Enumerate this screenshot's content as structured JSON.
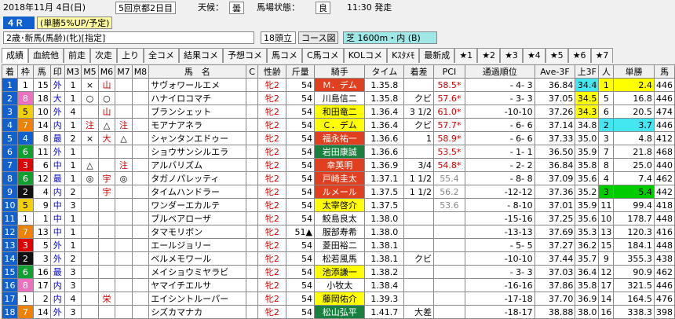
{
  "header": {
    "date": "2018年11月 4日(日)",
    "meeting": "5回京都2日目",
    "weather_label": "天候：",
    "weather": "曇",
    "track_label": "馬場状態：",
    "track": "良",
    "post_time": "11:30 発走"
  },
  "race": {
    "number": "４Ｒ",
    "odds_note": "(単勝5%UP/予定)",
    "conditions": "2歳･新馬(馬齢)(牝)[指定]",
    "head_count": "18頭立",
    "course_btn": "コース図",
    "course": "芝 1600m・内 (B)"
  },
  "tabs": [
    "成績",
    "血統他",
    "前走",
    "次走",
    "上り",
    "全コメ",
    "結果コメ",
    "予想コメ",
    "馬コメ",
    "C馬コメ",
    "KOLコメ",
    "Kｽﾀﾒﾓ",
    "最新成",
    "★1",
    "★2",
    "★3",
    "★4",
    "★5",
    "★6",
    "★7"
  ],
  "colors": {
    "waku": [
      "#ffffff",
      "#111111",
      "#e00000",
      "#1060d0",
      "#f0d000",
      "#10a030",
      "#f08000",
      "#f070c0"
    ],
    "waku_text": [
      "#000000",
      "#ffffff",
      "#ffffff",
      "#ffffff",
      "#000000",
      "#ffffff",
      "#ffffff",
      "#ffffff"
    ]
  },
  "columns": [
    "着",
    "枠",
    "馬",
    "印",
    "M3",
    "M5",
    "M6",
    "M7",
    "M8",
    "馬　名",
    "C",
    "性齢",
    "斤量",
    "騎手",
    "タイム",
    "着差",
    "PCI",
    "通過順位",
    "Ave-3F",
    "上3F",
    "人",
    "単勝",
    "馬"
  ],
  "rows": [
    {
      "rank": "1",
      "waku": "1",
      "num": "15",
      "mark": "外",
      "m3": "1",
      "m5": "×",
      "m6": "山",
      "m7": "",
      "m8": "",
      "name": "サヴォワールエメ",
      "c": "",
      "sex": "牝2",
      "wt": "54",
      "wt_mark": "",
      "jockey": "Ｍ．デム",
      "jbg": "#e04020",
      "jfg": "#ffffff",
      "time": "1.35.8",
      "margin": "",
      "pci": "58.5*",
      "pass": "- 4- 3",
      "ave": "36.84",
      "up3": "34.4",
      "up3bg": "cyn",
      "pop": "1",
      "popbg": "ylw",
      "odds": "2.4",
      "oddsbg": "ylw",
      "last": "446"
    },
    {
      "rank": "2",
      "waku": "8",
      "num": "18",
      "mark": "大",
      "m3": "1",
      "m5": "○",
      "m6": "○",
      "m7": "",
      "m8": "",
      "name": "ハナイロコマチ",
      "c": "",
      "sex": "牝2",
      "wt": "54",
      "wt_mark": "",
      "jockey": "川島信二",
      "jbg": "#ffffff",
      "jfg": "#000000",
      "time": "1.35.8",
      "margin": "クビ",
      "pci": "57.6*",
      "pass": "- 3- 3",
      "ave": "37.05",
      "up3": "34.5",
      "up3bg": "ylw",
      "pop": "5",
      "popbg": "",
      "odds": "16.8",
      "oddsbg": "",
      "last": "446"
    },
    {
      "rank": "3",
      "waku": "5",
      "num": "10",
      "mark": "外",
      "m3": "4",
      "m5": "",
      "m6": "山",
      "m7": "",
      "m8": "",
      "name": "ブランシェット",
      "c": "",
      "sex": "牝2",
      "wt": "54",
      "wt_mark": "",
      "jockey": "和田竜二",
      "jbg": "#ffff00",
      "jfg": "#000000",
      "time": "1.36.4",
      "margin": "3 1/2",
      "pci": "61.0*",
      "pass": "-10-10",
      "ave": "37.26",
      "up3": "34.3",
      "up3bg": "ylw",
      "pop": "6",
      "popbg": "",
      "odds": "20.5",
      "oddsbg": "",
      "last": "474"
    },
    {
      "rank": "4",
      "waku": "7",
      "num": "14",
      "mark": "内",
      "m3": "1",
      "m5": "注",
      "m6": "△",
      "m7": "注",
      "m8": "",
      "name": "モアナアネラ",
      "c": "",
      "sex": "牝2",
      "wt": "54",
      "wt_mark": "",
      "jockey": "Ｃ．デム",
      "jbg": "#ffff00",
      "jfg": "#000000",
      "time": "1.36.4",
      "margin": "クビ",
      "pci": "57.7*",
      "pass": "- 6- 6",
      "ave": "37.14",
      "up3": "34.8",
      "up3bg": "",
      "pop": "2",
      "popbg": "cyn",
      "odds": "3.7",
      "oddsbg": "cyn",
      "last": "446"
    },
    {
      "rank": "5",
      "waku": "4",
      "num": "8",
      "mark": "最",
      "m3": "2",
      "m5": "×",
      "m6": "大",
      "m7": "△",
      "m8": "",
      "name": "シャンタンエドゥー",
      "c": "",
      "sex": "牝2",
      "wt": "54",
      "wt_mark": "",
      "jockey": "福永祐一",
      "jbg": "#e04020",
      "jfg": "#ffffff",
      "time": "1.36.6",
      "margin": "1",
      "pci": "58.9*",
      "pass": "- 6- 6",
      "ave": "37.33",
      "up3": "35.0",
      "up3bg": "",
      "pop": "3",
      "popbg": "",
      "odds": "4.8",
      "oddsbg": "",
      "last": "412"
    },
    {
      "rank": "6",
      "waku": "6",
      "num": "11",
      "mark": "外",
      "m3": "1",
      "m5": "",
      "m6": "",
      "m7": "",
      "m8": "",
      "name": "ショウサンシルエラ",
      "c": "",
      "sex": "牝2",
      "wt": "54",
      "wt_mark": "",
      "jockey": "岩田康誠",
      "jbg": "#1a8040",
      "jfg": "#ffffff",
      "time": "1.36.6",
      "margin": "",
      "pci": "53.5*",
      "pass": "- 1- 1",
      "ave": "36.50",
      "up3": "35.9",
      "up3bg": "",
      "pop": "7",
      "popbg": "",
      "odds": "21.8",
      "oddsbg": "",
      "last": "468"
    },
    {
      "rank": "7",
      "waku": "3",
      "num": "6",
      "mark": "中",
      "m3": "1",
      "m5": "△",
      "m6": "",
      "m7": "注",
      "m8": "",
      "name": "アルバリズム",
      "c": "",
      "sex": "牝2",
      "wt": "54",
      "wt_mark": "",
      "jockey": "幸英明",
      "jbg": "#e04020",
      "jfg": "#ffffff",
      "time": "1.36.9",
      "margin": "3/4",
      "pci": "54.8*",
      "pass": "- 2- 2",
      "ave": "36.84",
      "up3": "35.8",
      "up3bg": "",
      "pop": "8",
      "popbg": "",
      "odds": "25.0",
      "oddsbg": "",
      "last": "440"
    },
    {
      "rank": "8",
      "waku": "6",
      "num": "12",
      "mark": "最",
      "m3": "1",
      "m5": "◎",
      "m6": "宇",
      "m7": "◎",
      "m8": "",
      "name": "タガノパレッティ",
      "c": "",
      "sex": "牝2",
      "wt": "54",
      "wt_mark": "",
      "jockey": "戸崎圭太",
      "jbg": "#e04020",
      "jfg": "#ffffff",
      "time": "1.37.1",
      "margin": "1 1/2",
      "pci": "55.4",
      "pass": "- 8- 8",
      "ave": "37.09",
      "up3": "35.6",
      "up3bg": "",
      "pop": "4",
      "popbg": "",
      "odds": "7.4",
      "oddsbg": "",
      "last": "462"
    },
    {
      "rank": "9",
      "waku": "2",
      "num": "4",
      "mark": "内",
      "m3": "2",
      "m5": "",
      "m6": "宇",
      "m7": "",
      "m8": "",
      "name": "タイムハンドラー",
      "c": "",
      "sex": "牝2",
      "wt": "54",
      "wt_mark": "",
      "jockey": "ルメール",
      "jbg": "#e04020",
      "jfg": "#ffffff",
      "time": "1.37.5",
      "margin": "1 1/2",
      "pci": "56.2",
      "pass": "-12-12",
      "ave": "37.36",
      "up3": "35.2",
      "up3bg": "",
      "pop": "3",
      "popbg": "grn",
      "odds": "5.4",
      "oddsbg": "grn",
      "last": "442"
    },
    {
      "rank": "10",
      "waku": "5",
      "num": "9",
      "mark": "中",
      "m3": "3",
      "m5": "",
      "m6": "",
      "m7": "",
      "m8": "",
      "name": "ワンダーエカルテ",
      "c": "",
      "sex": "牝2",
      "wt": "54",
      "wt_mark": "",
      "jockey": "太宰啓介",
      "jbg": "#ffff00",
      "jfg": "#000000",
      "time": "1.37.5",
      "margin": "",
      "pci": "53.6",
      "pass": "- 8-10",
      "ave": "37.01",
      "up3": "35.9",
      "up3bg": "",
      "pop": "11",
      "popbg": "",
      "odds": "99.4",
      "oddsbg": "",
      "last": "418"
    },
    {
      "rank": "11",
      "waku": "1",
      "num": "1",
      "mark": "中",
      "m3": "1",
      "m5": "",
      "m6": "",
      "m7": "",
      "m8": "",
      "name": "ブルベアローザ",
      "c": "",
      "sex": "牝2",
      "wt": "54",
      "wt_mark": "",
      "jockey": "鮫島良太",
      "jbg": "#ffffff",
      "jfg": "#000000",
      "time": "1.38.0",
      "margin": "",
      "pci": "",
      "pass": "-15-16",
      "ave": "37.25",
      "up3": "35.6",
      "up3bg": "",
      "pop": "10",
      "popbg": "",
      "odds": "178.7",
      "oddsbg": "",
      "last": "448"
    },
    {
      "rank": "12",
      "waku": "7",
      "num": "13",
      "mark": "中",
      "m3": "1",
      "m5": "",
      "m6": "",
      "m7": "",
      "m8": "",
      "name": "タマモリボン",
      "c": "",
      "sex": "牝2",
      "wt": "51",
      "wt_mark": "▲",
      "jockey": "服部寿希",
      "jbg": "#ffffff",
      "jfg": "#000000",
      "time": "1.38.0",
      "margin": "",
      "pci": "",
      "pass": "-13-13",
      "ave": "37.69",
      "up3": "35.3",
      "up3bg": "",
      "pop": "13",
      "popbg": "",
      "odds": "120.3",
      "oddsbg": "",
      "last": "416"
    },
    {
      "rank": "13",
      "waku": "3",
      "num": "5",
      "mark": "外",
      "m3": "1",
      "m5": "",
      "m6": "",
      "m7": "",
      "m8": "",
      "name": "エールジョリー",
      "c": "",
      "sex": "牝2",
      "wt": "54",
      "wt_mark": "",
      "jockey": "菱田裕二",
      "jbg": "#ffffff",
      "jfg": "#000000",
      "time": "1.38.1",
      "margin": "",
      "pci": "",
      "pass": "- 5- 5",
      "ave": "37.27",
      "up3": "36.2",
      "up3bg": "",
      "pop": "15",
      "popbg": "",
      "odds": "184.1",
      "oddsbg": "",
      "last": "448"
    },
    {
      "rank": "14",
      "waku": "2",
      "num": "3",
      "mark": "外",
      "m3": "2",
      "m5": "",
      "m6": "",
      "m7": "",
      "m8": "",
      "name": "ベルメモワール",
      "c": "",
      "sex": "牝2",
      "wt": "54",
      "wt_mark": "",
      "jockey": "松若風馬",
      "jbg": "#ffffff",
      "jfg": "#000000",
      "time": "1.38.1",
      "margin": "クビ",
      "pci": "",
      "pass": "-10-10",
      "ave": "37.44",
      "up3": "35.7",
      "up3bg": "",
      "pop": "9",
      "popbg": "",
      "odds": "355.3",
      "oddsbg": "",
      "last": "438"
    },
    {
      "rank": "15",
      "waku": "6",
      "num": "16",
      "mark": "最",
      "m3": "3",
      "m5": "",
      "m6": "",
      "m7": "",
      "m8": "",
      "name": "メイショウミヤラビ",
      "c": "",
      "sex": "牝2",
      "wt": "54",
      "wt_mark": "",
      "jockey": "池添謙一",
      "jbg": "#ffff00",
      "jfg": "#000000",
      "time": "1.38.2",
      "margin": "",
      "pci": "",
      "pass": "- 3- 3",
      "ave": "37.03",
      "up3": "36.4",
      "up3bg": "",
      "pop": "12",
      "popbg": "",
      "odds": "90.9",
      "oddsbg": "",
      "last": "462"
    },
    {
      "rank": "16",
      "waku": "8",
      "num": "17",
      "mark": "内",
      "m3": "3",
      "m5": "",
      "m6": "",
      "m7": "",
      "m8": "",
      "name": "ヤマイチエルサ",
      "c": "",
      "sex": "牝2",
      "wt": "54",
      "wt_mark": "",
      "jockey": "小牧太",
      "jbg": "#ffffff",
      "jfg": "#000000",
      "time": "1.38.4",
      "margin": "",
      "pci": "",
      "pass": "-16-16",
      "ave": "37.86",
      "up3": "35.8",
      "up3bg": "",
      "pop": "17",
      "popbg": "",
      "odds": "321.5",
      "oddsbg": "",
      "last": "446"
    },
    {
      "rank": "17",
      "waku": "1",
      "num": "2",
      "mark": "内",
      "m3": "4",
      "m5": "",
      "m6": "栄",
      "m7": "",
      "m8": "",
      "name": "エイシントルーパー",
      "c": "",
      "sex": "牝2",
      "wt": "54",
      "wt_mark": "",
      "jockey": "藤岡佑介",
      "jbg": "#ffff00",
      "jfg": "#000000",
      "time": "1.39.3",
      "margin": "",
      "pci": "",
      "pass": "-17-18",
      "ave": "37.70",
      "up3": "36.9",
      "up3bg": "",
      "pop": "14",
      "popbg": "",
      "odds": "164.5",
      "oddsbg": "",
      "last": "476"
    },
    {
      "rank": "18",
      "waku": "7",
      "num": "14",
      "mark": "外",
      "m3": "3",
      "m5": "",
      "m6": "",
      "m7": "",
      "m8": "",
      "name": "シズカマナカ",
      "c": "",
      "sex": "牝2",
      "wt": "54",
      "wt_mark": "",
      "jockey": "松山弘平",
      "jbg": "#1a8040",
      "jfg": "#ffffff",
      "time": "1.41.7",
      "margin": "大差",
      "pci": "",
      "pass": "-18-17",
      "ave": "38.88",
      "up3": "38.0",
      "up3bg": "",
      "pop": "16",
      "popbg": "",
      "odds": "338.3",
      "oddsbg": "",
      "last": "398"
    }
  ]
}
